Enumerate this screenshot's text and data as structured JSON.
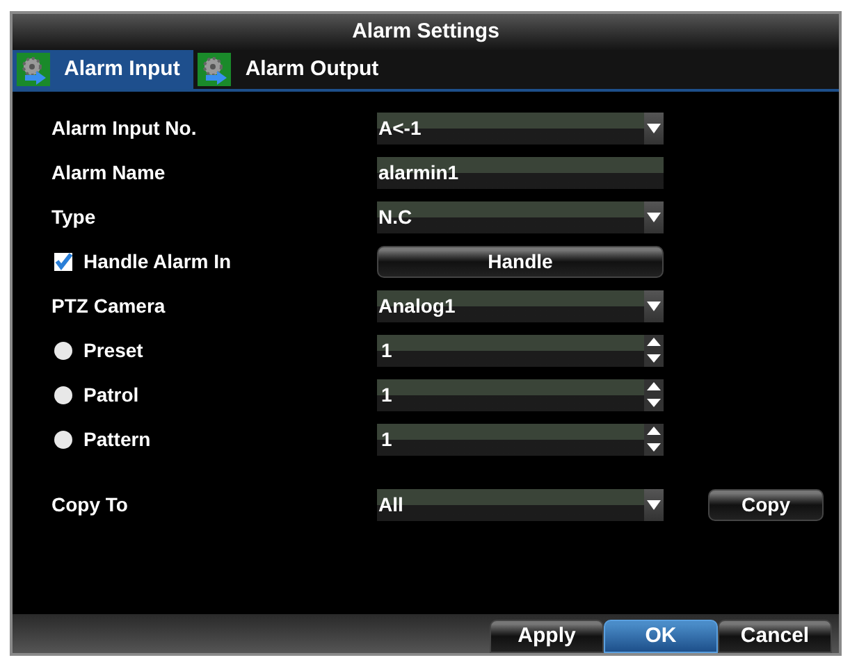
{
  "window": {
    "title": "Alarm Settings"
  },
  "tabs": [
    {
      "label": "Alarm Input",
      "selected": true
    },
    {
      "label": "Alarm Output",
      "selected": false
    }
  ],
  "rows": [
    {
      "label": "Alarm Input No.",
      "kind": "plain",
      "control": {
        "kind": "dropdown",
        "value": "A<-1"
      }
    },
    {
      "label": "Alarm Name",
      "kind": "plain",
      "control": {
        "kind": "text",
        "value": "alarmin1"
      }
    },
    {
      "label": "Type",
      "kind": "plain",
      "control": {
        "kind": "dropdown",
        "value": "N.C"
      }
    },
    {
      "label": "Handle Alarm In",
      "kind": "checkbox",
      "checked": true,
      "control": {
        "kind": "button",
        "value": "Handle"
      }
    },
    {
      "label": "PTZ Camera",
      "kind": "plain",
      "control": {
        "kind": "dropdown",
        "value": "Analog1"
      }
    },
    {
      "label": "Preset",
      "kind": "radio",
      "selected": false,
      "control": {
        "kind": "spinner",
        "value": "1"
      }
    },
    {
      "label": "Patrol",
      "kind": "radio",
      "selected": false,
      "control": {
        "kind": "spinner",
        "value": "1"
      }
    },
    {
      "label": "Pattern",
      "kind": "radio",
      "selected": false,
      "control": {
        "kind": "spinner",
        "value": "1"
      }
    }
  ],
  "copy_to": {
    "label": "Copy To",
    "value": "All",
    "button": "Copy"
  },
  "footer_buttons": [
    {
      "label": "Apply",
      "selected": false
    },
    {
      "label": "OK",
      "selected": true
    },
    {
      "label": "Cancel",
      "selected": false
    }
  ]
}
